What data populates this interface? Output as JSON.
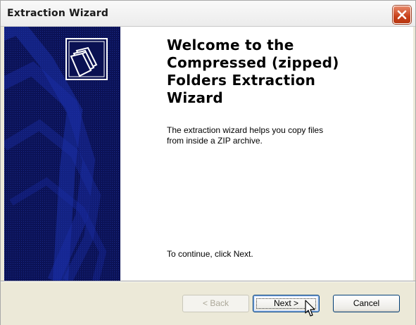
{
  "window": {
    "title": "Extraction Wizard",
    "close_icon": "close-icon"
  },
  "side_panel": {
    "icon": "folders-icon",
    "background_color": "#0a1152"
  },
  "main": {
    "heading_line1": "Welcome to the",
    "heading_line2": "Compressed (zipped)",
    "heading_line3": "Folders Extraction",
    "heading_line4": "Wizard",
    "description_line1": "The extraction wizard helps you copy files",
    "description_line2": "from inside a ZIP archive.",
    "continue_text": "To continue, click Next."
  },
  "buttons": {
    "back_label": "< Back",
    "next_label": "Next >",
    "cancel_label": "Cancel"
  },
  "colors": {
    "close_button": "#c8401a",
    "dialog_background": "#ece9d8",
    "focus_border": "#003c74"
  }
}
